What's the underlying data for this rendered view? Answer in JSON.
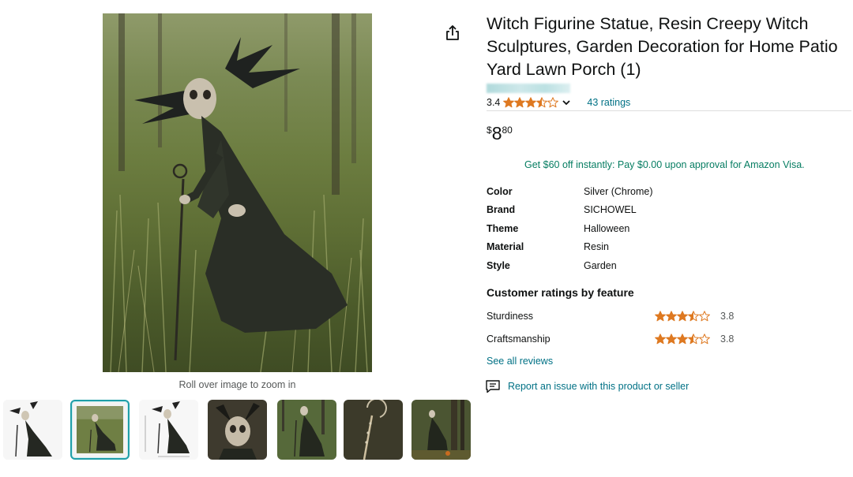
{
  "product": {
    "title": "Witch Figurine Statue, Resin Creepy Witch Sculptures, Garden Decoration for Home Patio Yard Lawn Porch (1)",
    "rating_value": "3.4",
    "rating_stars": 3.5,
    "ratings_count_label": "43 ratings",
    "price": {
      "symbol": "$",
      "whole": "8",
      "fraction": "80"
    },
    "promo": "Get $60 off instantly: Pay $0.00 upon approval for Amazon Visa."
  },
  "gallery": {
    "zoom_hint": "Roll over image to zoom in",
    "selected_index": 1,
    "thumbnail_count": 7
  },
  "specs": [
    {
      "label": "Color",
      "value": "Silver (Chrome)"
    },
    {
      "label": "Brand",
      "value": "SICHOWEL"
    },
    {
      "label": "Theme",
      "value": "Halloween"
    },
    {
      "label": "Material",
      "value": "Resin"
    },
    {
      "label": "Style",
      "value": "Garden"
    }
  ],
  "feature_ratings": {
    "title": "Customer ratings by feature",
    "items": [
      {
        "name": "Sturdiness",
        "value": "3.8",
        "stars": 3.5
      },
      {
        "name": "Craftsmanship",
        "value": "3.8",
        "stars": 3.5
      }
    ],
    "see_all": "See all reviews"
  },
  "report_issue": "Report an issue with this product or seller",
  "colors": {
    "link": "#007185",
    "promo": "#067d62",
    "star": "#de7921",
    "selected_thumb": "#1f9ea8"
  },
  "icons": [
    "share-icon",
    "star-icon",
    "chevron-down-icon",
    "feedback-icon"
  ]
}
